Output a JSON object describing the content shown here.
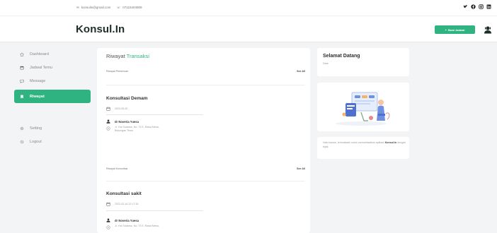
{
  "topbar": {
    "email": "konsulin@gmail.com",
    "phone": "07115404909",
    "social_icons": [
      "twitter-icon",
      "facebook-icon",
      "instagram-icon",
      "linkedin-icon"
    ]
  },
  "navbar": {
    "brand": "Konsul.In",
    "buat_jadwal_label": "Buat Jadwal"
  },
  "sidebar": {
    "items": [
      {
        "label": "Dashboard",
        "icon": "home-icon"
      },
      {
        "label": "Jadwal Temu",
        "icon": "calendar-icon"
      },
      {
        "label": "Message",
        "icon": "message-icon"
      },
      {
        "label": "Riwayat",
        "icon": "bookmark-icon",
        "active": true
      },
      {
        "label": "Setting",
        "icon": "gear-icon"
      },
      {
        "label": "Logout",
        "icon": "logout-icon"
      }
    ]
  },
  "riwayat": {
    "title_prefix": "Riwayat",
    "title_accent": "Transaksi",
    "sections": [
      {
        "heading": "Riwayat Pertemuan",
        "see_all": "See All",
        "title": "Konsultasi Demam",
        "date": "2022-05-30",
        "doctor": "dr Noveria Yuesa",
        "address_line1": "Jl. Yos Sudarso, No. 73 E, Rawa Mesa,",
        "address_line2": "Bukungan Timur"
      },
      {
        "heading": "Riwayat Konsultasi",
        "see_all": "See All",
        "title": "Konsultasi sakit",
        "date": "2022-02-16 22:17:15",
        "doctor": "dr Noveria Yuesa",
        "address_line1": "Jl. Yos Sudarso, No. 73 E, Rawa Mesa,"
      }
    ]
  },
  "welcome": {
    "title": "Selamat Datang",
    "subtitle": "Dear"
  },
  "info": {
    "text_before": "Halo kawan, terimakasih untuk memanfaatkan aplikasi",
    "brand": "Konsul.In",
    "text_after": "dengan bijak."
  },
  "colors": {
    "accent": "#2fb380",
    "background": "#f3f4f6"
  }
}
